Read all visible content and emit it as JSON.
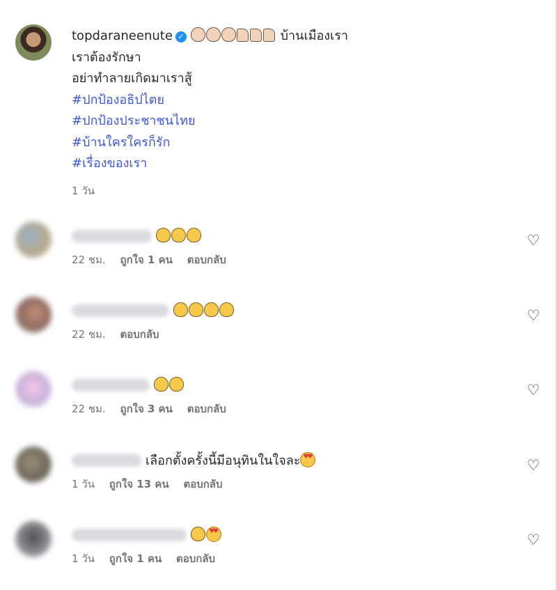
{
  "post": {
    "username": "topdaraneenute",
    "verified_icon": "verified-badge-icon",
    "caption_lines": [
      "บ้านเมืองเรา",
      "เราต้องรักษา",
      "อย่าทำลายเกิดมาเราสู้"
    ],
    "hashtags": [
      "#ปกป้องอธิปไตย",
      "#ปกป้องประชาชนไทย",
      "#บ้านใครใครก็รัก",
      "#เรื่องของเรา"
    ],
    "time": "1 วัน"
  },
  "comments": [
    {
      "text": "",
      "time": "22 ชม.",
      "likes": "ถูกใจ 1 คน",
      "reply": "ตอบกลับ"
    },
    {
      "text": "",
      "time": "22 ชม.",
      "likes": "",
      "reply": "ตอบกลับ"
    },
    {
      "text": "",
      "time": "22 ชม.",
      "likes": "ถูกใจ 3 คน",
      "reply": "ตอบกลับ"
    },
    {
      "text": "เลือกตั้งครั้งนี้มีอนุทินในใจละ",
      "time": "1 วัน",
      "likes": "ถูกใจ 13 คน",
      "reply": "ตอบกลับ"
    },
    {
      "text": "",
      "time": "1 วัน",
      "likes": "ถูกใจ 1 คน",
      "reply": "ตอบกลับ"
    }
  ],
  "icons": {
    "like": "heart-outline-icon",
    "clap": "clapping-hands-icon",
    "thumbs_up": "thumbs-up-icon",
    "heart_eyes": "heart-eyes-emoji-icon"
  },
  "colors": {
    "hashtag": "#3f58d6",
    "muted": "#737373",
    "verified": "#1f8ff3"
  }
}
